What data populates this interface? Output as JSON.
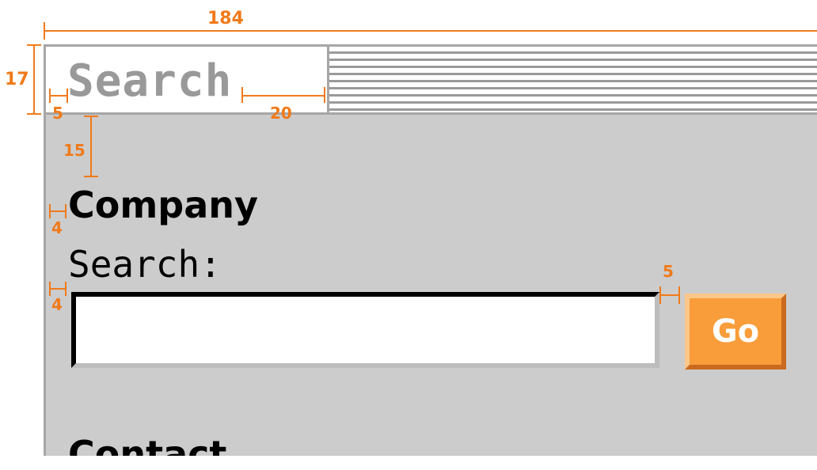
{
  "annotations": {
    "total_width": "184",
    "height": "17",
    "left_padding": "5",
    "right_gap": "20",
    "top_gap": "15",
    "heading_indent": "4",
    "input_indent": "4",
    "button_gap": "5"
  },
  "tabs": [
    {
      "label": "Search",
      "active": true
    }
  ],
  "sections": {
    "company": {
      "heading": "Company",
      "search_label": "Search:",
      "input_value": "",
      "go_label": "Go"
    },
    "contact": {
      "heading": "Contact"
    }
  },
  "colors": {
    "annotation": "#f07a1a",
    "panel": "#cccccc",
    "button": "#f99d3a"
  }
}
